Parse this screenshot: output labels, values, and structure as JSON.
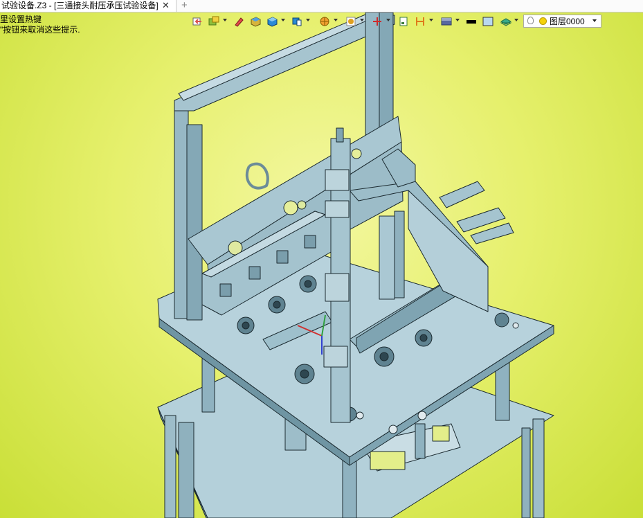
{
  "tab": {
    "title": "试验设备.Z3 - [三通接头耐压承压试验设备]",
    "close_glyph": "✕",
    "new_glyph": "+"
  },
  "hint": {
    "line1": "里设置热键",
    "line2": "\"按钮来取消这些提示."
  },
  "toolbar": {
    "tools": [
      {
        "name": "exit-sketch-icon",
        "color": "#d9534f"
      },
      {
        "name": "display-mode-icon",
        "color": "#8dbf3b"
      },
      {
        "name": "eraser-icon",
        "color": "#e04a4a"
      },
      {
        "name": "shaded-box-icon",
        "color": "#d6b43c"
      },
      {
        "name": "solid-box-icon",
        "color": "#2a8ad6"
      },
      {
        "name": "view-cube-icon",
        "color": "#2a8ad6"
      },
      {
        "name": "render-sphere-icon",
        "color": "#f0a030"
      },
      {
        "name": "zoom-window-icon",
        "color": "#e0a020"
      },
      {
        "name": "axis-triad-icon",
        "color": "#d02a2a"
      },
      {
        "name": "page-icon",
        "color": "#3a7a3a"
      },
      {
        "name": "dimension-icon",
        "color": "#e07a1a"
      },
      {
        "name": "background-icon",
        "color": "#5a6aa0"
      },
      {
        "name": "line-color-icon",
        "color": "#000000"
      },
      {
        "name": "face-color-icon",
        "color": "#b8d8f0"
      },
      {
        "name": "layer-stack-icon",
        "color": "#3aaa8a"
      }
    ],
    "layer": {
      "label": "图层0000"
    }
  },
  "colors": {
    "viewport_light": "#f3f7a0",
    "viewport_dark": "#c9df37",
    "metal": "#a8c7d3",
    "metal_dark": "#6f95a3",
    "edge": "#1b2a30"
  }
}
